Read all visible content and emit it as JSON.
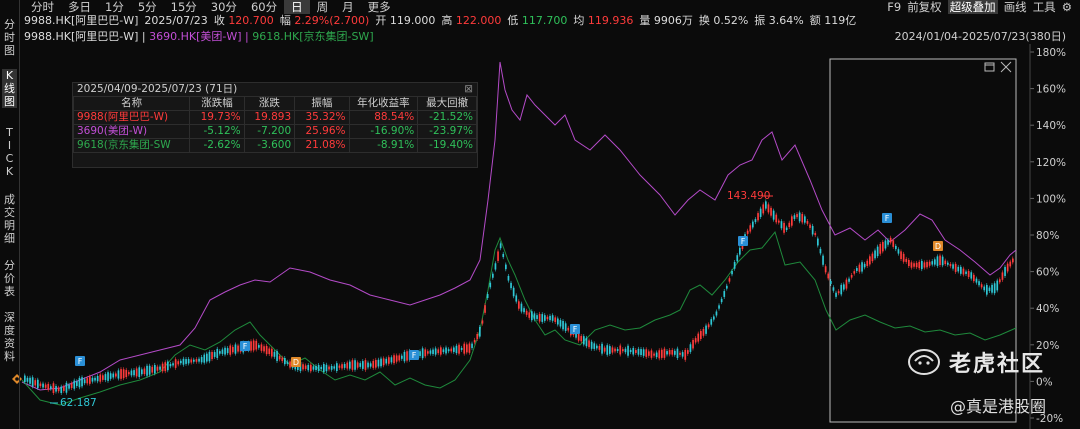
{
  "toolbar": {
    "periods": [
      "分时",
      "多日",
      "1分",
      "5分",
      "15分",
      "30分",
      "60分",
      "日",
      "周",
      "月",
      "更多"
    ],
    "active_period": "日",
    "right": [
      "F9",
      "前复权",
      "超级叠加",
      "画线",
      "工具",
      "⚙"
    ],
    "right_highlight": "超级叠加"
  },
  "quote": {
    "symbol": "9988.HK[阿里巴巴-W]",
    "date": "2025/07/23",
    "close_label": "收",
    "close": "120.700",
    "change_label": "幅",
    "change": "2.29%(2.700)",
    "open_label": "开",
    "open": "119.000",
    "high_label": "高",
    "high": "122.000",
    "low_label": "低",
    "low": "117.700",
    "avg_label": "均",
    "avg": "119.936",
    "volume_label": "量",
    "volume": "9906万",
    "turnover_label": "换",
    "turnover": "0.52%",
    "amplitude_label": "振",
    "amplitude": "3.64%",
    "amount_label": "额",
    "amount": "119亿"
  },
  "legend": {
    "s1": "9988.HK[阿里巴巴-W] |",
    "s2": "3690.HK[美团-W] |",
    "s3": "9618.HK[京东集团-SW]",
    "range": "2024/01/04-2025/07/23(380日)"
  },
  "left_tabs": [
    "分时图",
    "K线图",
    "TICK",
    "成交明细",
    "分价表",
    "深度资料"
  ],
  "active_tab": "K线图",
  "stats": {
    "title": "2025/04/09-2025/07/23 (71日)",
    "close_symbol": "⊠",
    "headers": [
      "名称",
      "涨跌幅",
      "涨跌",
      "振幅",
      "年化收益率",
      "最大回撤"
    ],
    "rows": [
      {
        "name": "9988(阿里巴巴-W)",
        "chg_pct": "19.73%",
        "chg": "19.893",
        "amp": "35.32%",
        "annual": "88.54%",
        "mdd": "-21.52%",
        "color": "#ff3b3b"
      },
      {
        "name": "3690(美团-W)",
        "chg_pct": "-5.12%",
        "chg": "-7.200",
        "amp": "25.96%",
        "annual": "-16.90%",
        "mdd": "-23.97%",
        "color": "#c24fd6"
      },
      {
        "name": "9618(京东集团-SW",
        "chg_pct": "-2.62%",
        "chg": "-3.600",
        "amp": "21.08%",
        "annual": "-8.91%",
        "mdd": "-19.40%",
        "color": "#2ea84e"
      }
    ]
  },
  "chart": {
    "y_labels": [
      "180%",
      "160%",
      "140%",
      "120%",
      "100%",
      "80%",
      "60%",
      "40%",
      "20%",
      "0%",
      "-20%"
    ],
    "annotation_high": "143.490",
    "annotation_low": "62.187",
    "markers": [
      "F",
      "F",
      "D",
      "F",
      "F",
      "F",
      "F",
      "D"
    ],
    "colors": {
      "alibaba_up": "#ff3b3b",
      "alibaba_down": "#2fc8d6",
      "meituan": "#b44bc8",
      "jd": "#1f8a3c",
      "f_marker": "#2a8fd6",
      "d_marker": "#e0892a"
    }
  },
  "watermark": {
    "brand": "老虎社区",
    "handle": "@真是港股圈"
  }
}
